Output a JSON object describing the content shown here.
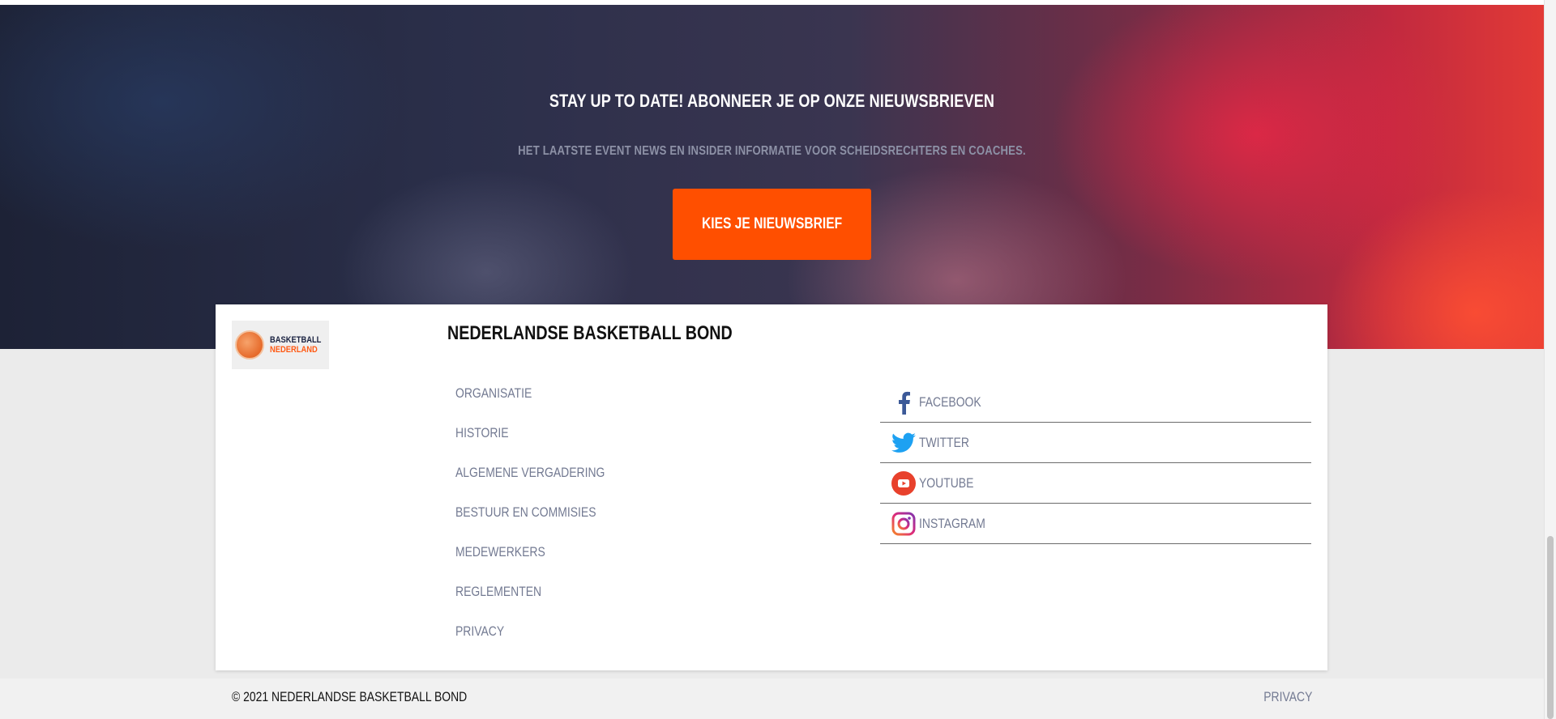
{
  "hero": {
    "title": "STAY UP TO DATE! ABONNEER JE OP ONZE NIEUWSBRIEVEN",
    "subtitle": "HET LAATSTE EVENT NEWS EN INSIDER INFORMATIE VOOR SCHEIDSRECHTERS EN COACHES.",
    "cta_label": "KIES JE NIEUWSBRIEF"
  },
  "colors": {
    "accent": "#ff4f00",
    "link": "#737a92",
    "facebook": "#3b5998",
    "twitter": "#1da1f2",
    "youtube": "#e8412c",
    "instagram": "#c13584"
  },
  "footer": {
    "logo": {
      "line1": "BASKETBALL",
      "line2": "NEDERLAND"
    },
    "heading": "NEDERLANDSE BASKETBALL BOND",
    "links": [
      "ORGANISATIE",
      "HISTORIE",
      "ALGEMENE VERGADERING",
      "BESTUUR EN COMMISIES",
      "MEDEWERKERS",
      "REGLEMENTEN",
      "PRIVACY"
    ],
    "social": [
      {
        "label": "FACEBOOK",
        "icon": "facebook-icon"
      },
      {
        "label": "TWITTER",
        "icon": "twitter-icon"
      },
      {
        "label": "YOUTUBE",
        "icon": "youtube-icon"
      },
      {
        "label": "INSTAGRAM",
        "icon": "instagram-icon"
      }
    ]
  },
  "bottom": {
    "copyright": "© 2021 NEDERLANDSE BASKETBALL BOND",
    "privacy": "PRIVACY"
  }
}
